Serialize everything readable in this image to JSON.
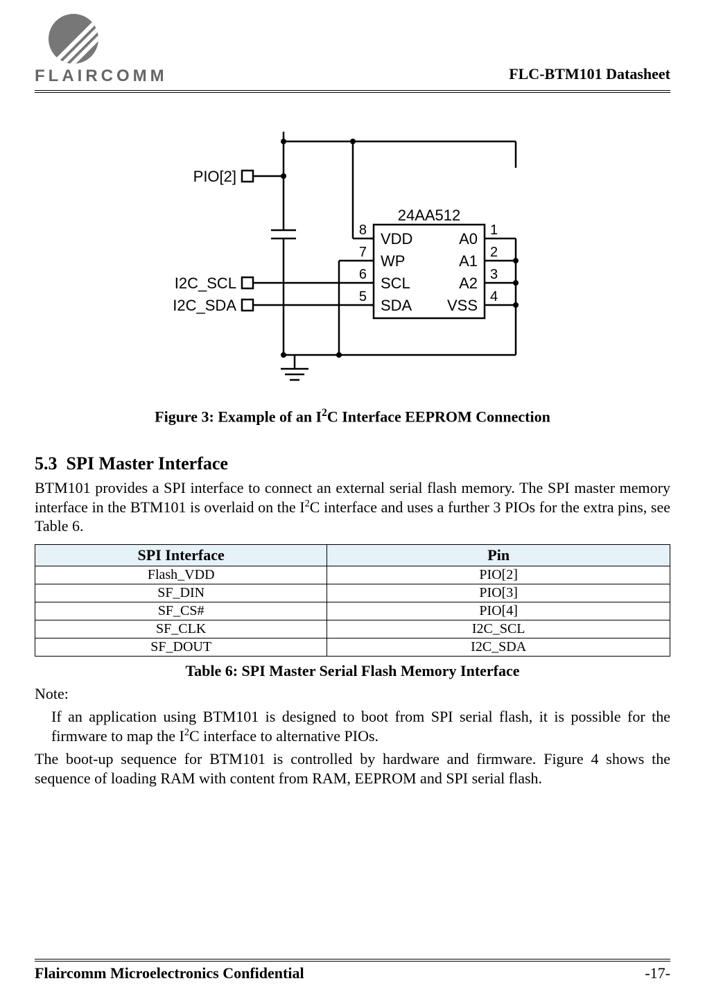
{
  "header": {
    "brand": "FLAIRCOMM",
    "doc_title": "FLC-BTM101 Datasheet"
  },
  "figure": {
    "caption_prefix": "Figure 3: Example of an I",
    "caption_sup": "2",
    "caption_suffix": "C Interface EEPROM Connection",
    "chip_name": "24AA512",
    "left_signals": {
      "pio2": "PIO[2]",
      "i2c_scl": "I2C_SCL",
      "i2c_sda": "I2C_SDA"
    },
    "chip_pins_left": [
      "VDD",
      "WP",
      "SCL",
      "SDA"
    ],
    "chip_pins_left_nums": [
      "8",
      "7",
      "6",
      "5"
    ],
    "chip_pins_right": [
      "A0",
      "A1",
      "A2",
      "VSS"
    ],
    "chip_pins_right_nums": [
      "1",
      "2",
      "3",
      "4"
    ]
  },
  "section": {
    "number": "5.3",
    "title": "SPI Master Interface",
    "para1_a": "BTM101 provides a SPI interface to connect an external serial flash memory.  The SPI master memory interface in the BTM101 is overlaid on the I",
    "para1_sup": "2",
    "para1_b": "C interface and uses a further 3 PIOs for the extra pins, see Table 6."
  },
  "table": {
    "headers": [
      "SPI Interface",
      "Pin"
    ],
    "rows": [
      [
        "Flash_VDD",
        "PIO[2]"
      ],
      [
        "SF_DIN",
        "PIO[3]"
      ],
      [
        "SF_CS#",
        "PIO[4]"
      ],
      [
        "SF_CLK",
        "I2C_SCL"
      ],
      [
        "SF_DOUT",
        "I2C_SDA"
      ]
    ],
    "caption": "Table 6: SPI Master Serial Flash Memory Interface"
  },
  "note": {
    "label": "Note:",
    "body_a": "If an application using BTM101 is designed to boot from SPI serial flash, it is possible for the firmware to map the I",
    "body_sup": "2",
    "body_b": "C interface to alternative PIOs."
  },
  "para2": "The boot-up sequence for BTM101 is controlled by hardware and firmware. Figure 4 shows the sequence of loading RAM with content from RAM, EEPROM and SPI serial flash.",
  "footer": {
    "confidential": "Flaircomm Microelectronics Confidential",
    "page": "-17-"
  }
}
